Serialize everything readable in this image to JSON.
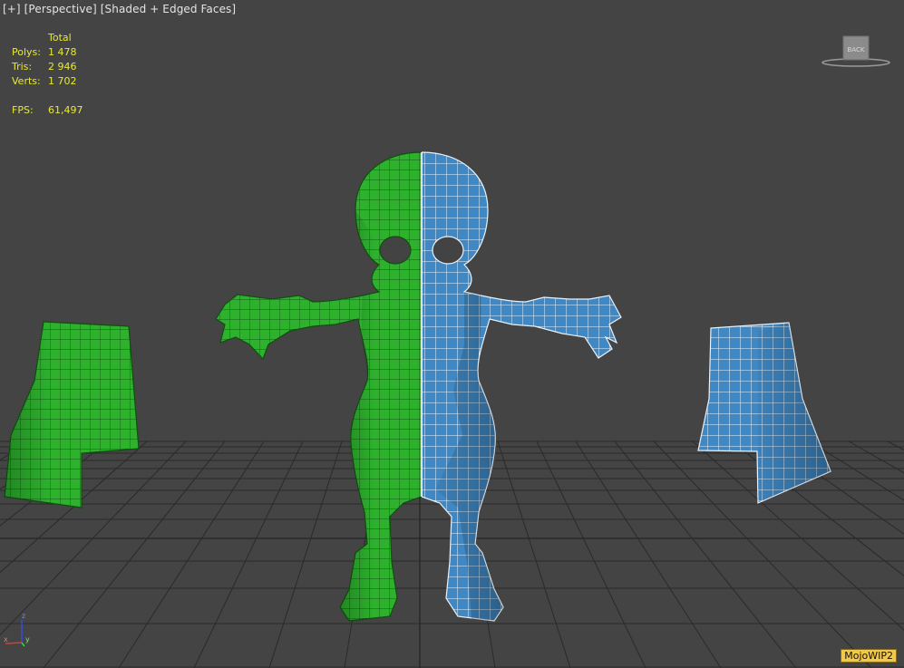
{
  "viewport": {
    "label_plus": "[+]",
    "label_view": "[Perspective]",
    "label_mode": "[Shaded + Edged Faces]"
  },
  "stats": {
    "header": "Total",
    "polys_label": "Polys:",
    "polys_value": "1 478",
    "tris_label": "Tris:",
    "tris_value": "2 946",
    "verts_label": "Verts:",
    "verts_value": "1 702",
    "fps_label": "FPS:",
    "fps_value": "61,497"
  },
  "viewcube": {
    "face_label": "BACK"
  },
  "axis": {
    "z": "z",
    "x": "x",
    "y": "y"
  },
  "badge": {
    "text": "MojoWIP2"
  },
  "colors": {
    "background": "#444444",
    "grid": "#2a2a2a",
    "green_mesh": "#2fb52f",
    "blue_mesh": "#3d88c6",
    "stats_text": "#e8e83a",
    "badge_bg": "#f2c84b"
  }
}
